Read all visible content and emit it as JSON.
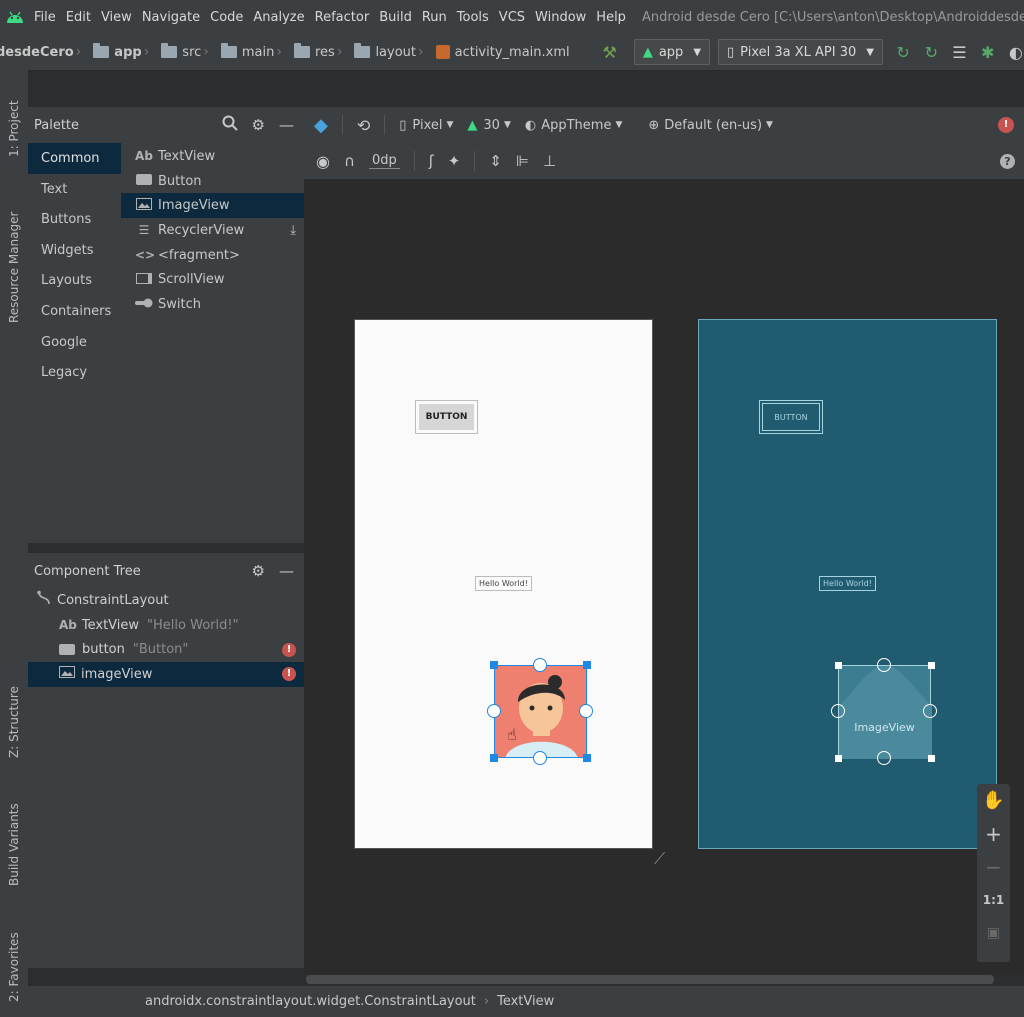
{
  "menubar": {
    "items": [
      "File",
      "Edit",
      "View",
      "Navigate",
      "Code",
      "Analyze",
      "Refactor",
      "Build",
      "Run",
      "Tools",
      "VCS",
      "Window",
      "Help"
    ],
    "window_title": "Android desde Cero [C:\\Users\\anton\\Desktop\\Androiddesde"
  },
  "navbar": {
    "crumbs": [
      "desdeCero",
      "app",
      "src",
      "main",
      "res",
      "layout",
      "activity_main.xml"
    ],
    "run_config": "app",
    "device": "Pixel 3a XL API 30"
  },
  "left_tabs": [
    "1: Project",
    "Resource Manager",
    "Z: Structure",
    "Build Variants",
    "2: Favorites"
  ],
  "palette": {
    "title": "Palette",
    "categories": [
      "Common",
      "Text",
      "Buttons",
      "Widgets",
      "Layouts",
      "Containers",
      "Google",
      "Legacy"
    ],
    "selected_category": "Common",
    "items": [
      {
        "icon": "Ab",
        "label": "TextView"
      },
      {
        "icon": "button-icon",
        "label": "Button"
      },
      {
        "icon": "image-icon",
        "label": "ImageView"
      },
      {
        "icon": "list-icon",
        "label": "RecyclerView"
      },
      {
        "icon": "code-icon",
        "label": "<fragment>"
      },
      {
        "icon": "scroll-icon",
        "label": "ScrollView"
      },
      {
        "icon": "switch-icon",
        "label": "Switch"
      }
    ]
  },
  "component_tree": {
    "title": "Component Tree",
    "nodes": [
      {
        "label": "ConstraintLayout",
        "sub": ""
      },
      {
        "label": "TextView",
        "sub": "\"Hello World!\""
      },
      {
        "label": "button",
        "sub": "\"Button\""
      },
      {
        "label": "imageView",
        "sub": ""
      }
    ]
  },
  "design_toolbar": {
    "device": "Pixel",
    "api": "30",
    "theme": "AppTheme",
    "locale": "Default (en-us)",
    "margin": "0dp"
  },
  "design": {
    "button_label": "BUTTON",
    "hello_text": "Hello World!",
    "imageview_label": "ImageView"
  },
  "zoom": {
    "ratio": "1:1"
  },
  "status": {
    "path": "androidx.constraintlayout.widget.ConstraintLayout",
    "current": "TextView"
  },
  "colors": {
    "accent": "#1e88e5",
    "blueprint": "#215b70",
    "error": "#c75450",
    "selection": "#0d293e",
    "android_green": "#3ddc84"
  }
}
